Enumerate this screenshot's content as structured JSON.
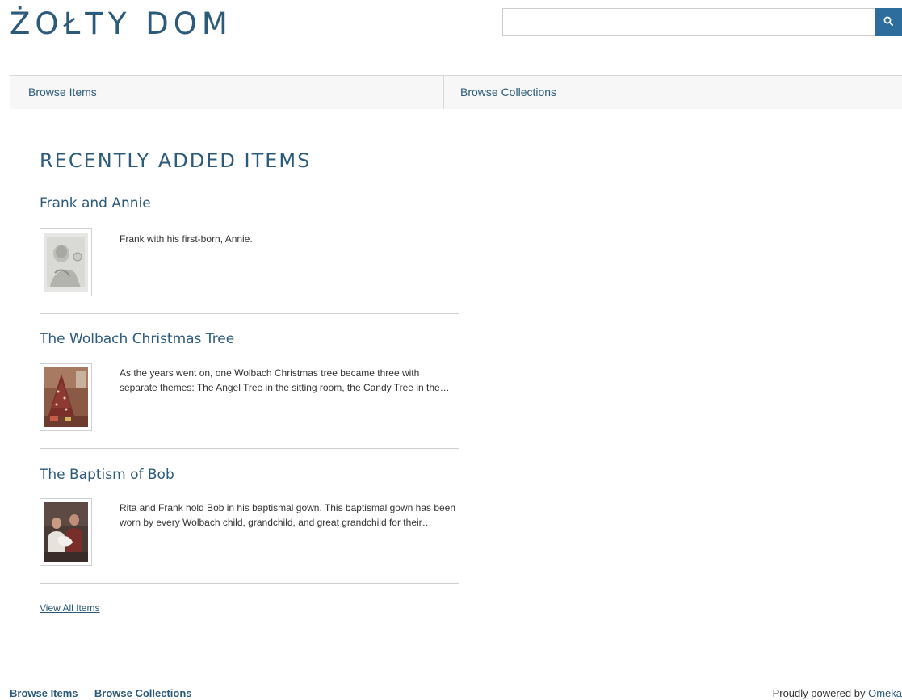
{
  "site": {
    "title": "ŻOŁTY DOM"
  },
  "search": {
    "value": "",
    "placeholder": "",
    "button_icon": "search-icon"
  },
  "nav": {
    "items": [
      {
        "label": "Browse Items"
      },
      {
        "label": "Browse Collections"
      }
    ]
  },
  "main": {
    "heading": "RECENTLY ADDED ITEMS",
    "items": [
      {
        "title": "Frank and Annie",
        "description": "Frank with his first-born, Annie.",
        "thumbnail": "black-and-white-photo-thumbnail"
      },
      {
        "title": "The Wolbach Christmas Tree",
        "description": "As the years went on, one Wolbach Christmas tree became three with separate themes: The Angel Tree in the sitting room, the Candy Tree in the…",
        "thumbnail": "christmas-tree-photo-thumbnail"
      },
      {
        "title": "The Baptism of Bob",
        "description": "Rita and Frank hold Bob in his baptismal gown. This baptismal gown has been worn by every Wolbach child, grandchild, and great grandchild for their…",
        "thumbnail": "baptism-photo-thumbnail"
      }
    ],
    "view_all_label": "View All Items"
  },
  "footer": {
    "nav": [
      {
        "label": "Browse Items"
      },
      {
        "label": "Browse Collections"
      }
    ],
    "separator": "·",
    "credit_prefix": "Proudly powered by",
    "credit_link": "Omeka"
  },
  "colors": {
    "accent": "#2c5a7a",
    "search_button": "#2c6d9e",
    "border": "#d8d8d8",
    "nav_background": "#f7f7f7"
  }
}
